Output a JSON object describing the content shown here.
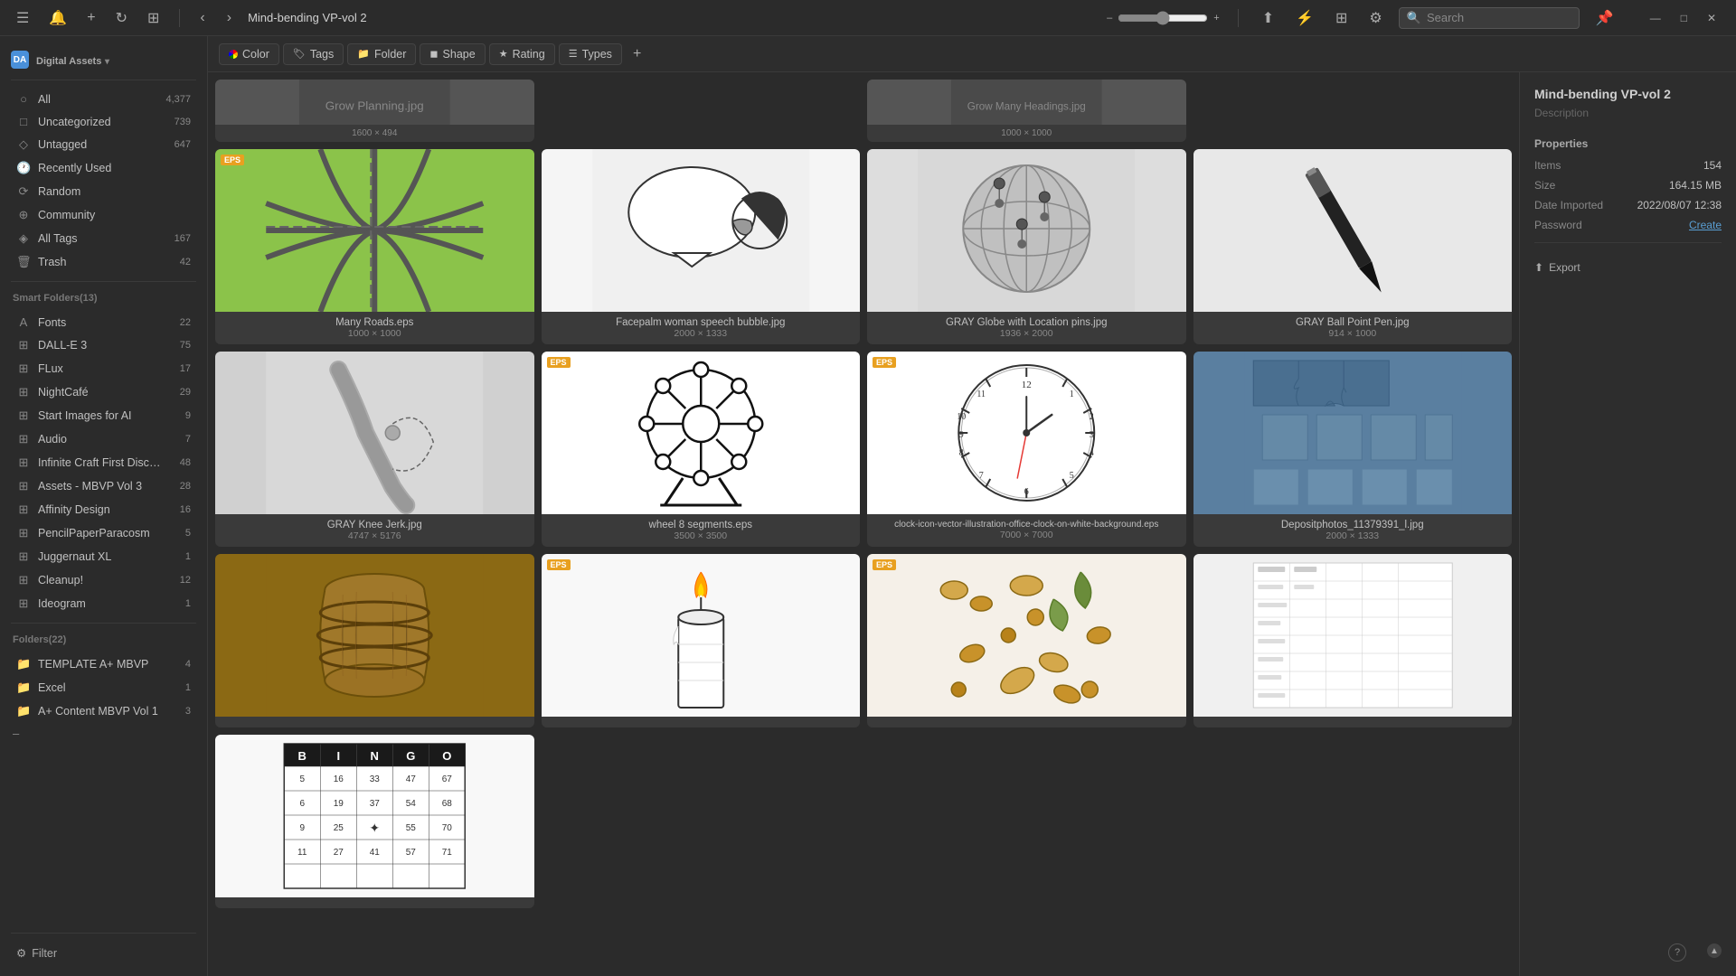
{
  "titlebar": {
    "menu_icon": "☰",
    "bell_icon": "🔔",
    "add_icon": "+",
    "back_icon": "‹",
    "nav_icon": "›",
    "breadcrumb": "Mind-bending VP-vol 2",
    "search_placeholder": "Search",
    "pin_icon": "📌",
    "minimize": "—",
    "maximize": "□",
    "close": "✕"
  },
  "toolbar": {
    "color": "Color",
    "tags": "Tags",
    "folder": "Folder",
    "shape": "Shape",
    "rating": "Rating",
    "types": "Types",
    "add": "+"
  },
  "sidebar": {
    "app_name": "Digital Assets",
    "app_icon": "DA",
    "categories": [
      {
        "label": "All",
        "count": "4,377",
        "icon": "○"
      },
      {
        "label": "Uncategorized",
        "count": "739",
        "icon": "□"
      },
      {
        "label": "Untagged",
        "count": "647",
        "icon": "◇"
      },
      {
        "label": "Recently Used",
        "count": "",
        "icon": "○"
      },
      {
        "label": "Random",
        "count": "",
        "icon": "⟳"
      },
      {
        "label": "Community",
        "count": "",
        "icon": "⊕"
      },
      {
        "label": "All Tags",
        "count": "167",
        "icon": "◈"
      },
      {
        "label": "Trash",
        "count": "42",
        "icon": "🗑"
      }
    ],
    "smart_folders_header": "Smart Folders(13)",
    "smart_folders": [
      {
        "label": "Fonts",
        "count": "22",
        "icon": "A"
      },
      {
        "label": "DALL-E 3",
        "count": "75",
        "icon": "⊞"
      },
      {
        "label": "FLux",
        "count": "17",
        "icon": "⊞"
      },
      {
        "label": "NightCafé",
        "count": "29",
        "icon": "⊞"
      },
      {
        "label": "Start Images for AI",
        "count": "9",
        "icon": "⊞"
      },
      {
        "label": "Audio",
        "count": "7",
        "icon": "⊞"
      },
      {
        "label": "Infinite Craft First Discov...",
        "count": "48",
        "icon": "⊞"
      },
      {
        "label": "Assets - MBVP Vol 3",
        "count": "28",
        "icon": "⊞"
      },
      {
        "label": "Affinity Design",
        "count": "16",
        "icon": "⊞"
      },
      {
        "label": "PencilPaperParacosm",
        "count": "5",
        "icon": "⊞"
      },
      {
        "label": "Juggernaut XL",
        "count": "1",
        "icon": "⊞"
      },
      {
        "label": "Cleanup!",
        "count": "12",
        "icon": "⊞"
      },
      {
        "label": "Ideogram",
        "count": "1",
        "icon": "⊞"
      }
    ],
    "folders_header": "Folders(22)",
    "folders": [
      {
        "label": "TEMPLATE A+ MBVP",
        "count": "4",
        "icon": "📁"
      },
      {
        "label": "Excel",
        "count": "1",
        "icon": "📁"
      },
      {
        "label": "A+ Content MBVP Vol 1",
        "count": "3",
        "icon": "📁"
      }
    ],
    "filter_label": "Filter"
  },
  "gallery": {
    "items": [
      {
        "name": "Many Roads.eps",
        "dims": "1000 × 1000",
        "has_eps": true,
        "color": "#8bc34a",
        "type": "roads"
      },
      {
        "name": "Facepalm woman speech bubble.jpg",
        "dims": "2000 × 1333",
        "has_eps": false,
        "type": "facepalm"
      },
      {
        "name": "GRAY Globe with Location pins.jpg",
        "dims": "1936 × 2000",
        "has_eps": false,
        "type": "globe"
      },
      {
        "name": "GRAY Ball Point Pen.jpg",
        "dims": "914 × 1000",
        "has_eps": false,
        "type": "pen"
      },
      {
        "name": "GRAY Knee Jerk.jpg",
        "dims": "4747 × 5176",
        "has_eps": false,
        "type": "knee"
      },
      {
        "name": "wheel 8 segments.eps",
        "dims": "3500 × 3500",
        "has_eps": true,
        "type": "wheel"
      },
      {
        "name": "clock-icon-vector-illustration-office-clock-on-white-background.eps",
        "dims": "7000 × 7000",
        "has_eps": true,
        "type": "clock"
      },
      {
        "name": "Depositphotos_11379391_l.jpg",
        "dims": "2000 × 1333",
        "has_eps": false,
        "type": "puzzle"
      },
      {
        "name": "barrel",
        "dims": "",
        "has_eps": false,
        "type": "barrel"
      },
      {
        "name": "candle",
        "dims": "",
        "has_eps": true,
        "type": "candle"
      },
      {
        "name": "nuts",
        "dims": "",
        "has_eps": true,
        "type": "nuts"
      },
      {
        "name": "chart",
        "dims": "",
        "has_eps": false,
        "type": "chart"
      },
      {
        "name": "bingo",
        "dims": "",
        "has_eps": false,
        "type": "bingo"
      }
    ]
  },
  "right_panel": {
    "title": "Mind-bending VP-vol 2",
    "description_label": "Description",
    "properties_label": "Properties",
    "items_label": "Items",
    "items_value": "154",
    "size_label": "Size",
    "size_value": "164.15 MB",
    "date_label": "Date Imported",
    "date_value": "2022/08/07  12:38",
    "password_label": "Password",
    "password_value": "Create",
    "export_label": "Export"
  }
}
